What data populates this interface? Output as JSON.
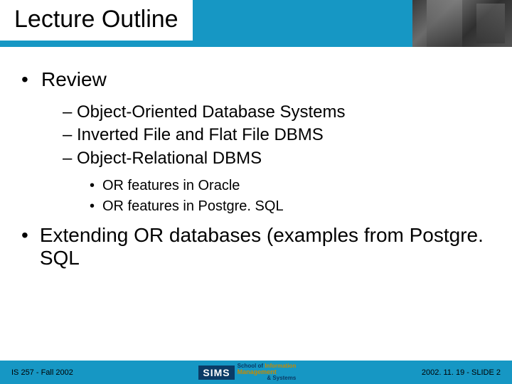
{
  "header": {
    "title": "Lecture Outline"
  },
  "body": {
    "b1_label": "Review",
    "sub1": "Object-Oriented Database Systems",
    "sub2": "Inverted File and Flat File DBMS",
    "sub3": "Object-Relational DBMS",
    "subsub1": "OR features in Oracle",
    "subsub2": "OR features in Postgre. SQL",
    "b2_label": "Extending OR databases (examples from Postgre. SQL"
  },
  "footer": {
    "left": "IS 257 - Fall 2002",
    "right": "2002. 11. 19 - SLIDE 2",
    "logo_main": "SIMS",
    "logo_l1": "School of",
    "logo_l2": "Information",
    "logo_l3": "& Systems",
    "logo_mid": "Management"
  }
}
